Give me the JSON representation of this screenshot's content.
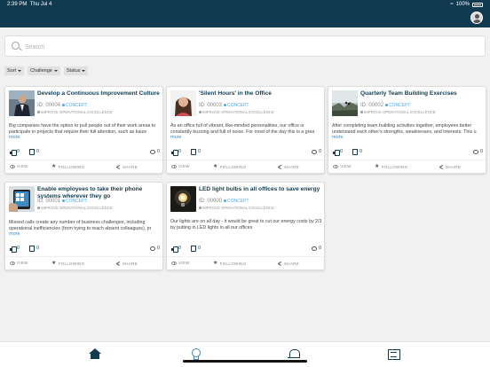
{
  "status_bar": {
    "time": "2:39 PM",
    "date": "Thu Jul 4",
    "battery": "100%"
  },
  "search": {
    "placeholder": "Search"
  },
  "filters": [
    {
      "label": "Sort"
    },
    {
      "label": "Challenge"
    },
    {
      "label": "Status"
    }
  ],
  "cards": [
    {
      "title": "Develop a Continuous Improvement Culture",
      "id": "ID: 00004",
      "stage": "CONCEPT",
      "challenge": "IMPROVE OPERATIONAL EXCELLENCE",
      "description": "Big companies have the option to pull people out of their work areas to participate in projects that require their full attention, such as kaize",
      "more": "more",
      "likes": "0",
      "dislikes": "0",
      "comments": "0",
      "view": "VIEW",
      "following": "FOLLOWING",
      "share": "SHARE",
      "thumb": "office-man"
    },
    {
      "title": "'Silent Hours' in the Office",
      "id": "ID: 00003",
      "stage": "CONCEPT",
      "challenge": "IMPROVE OPERATIONAL EXCELLENCE",
      "description": "As an office full of vibrant, like-minded personalities, our office is constantly buzzing and full of noise. For most of the day this is a grea",
      "more": "more",
      "likes": "0",
      "dislikes": "0",
      "comments": "0",
      "view": "VIEW",
      "following": "FOLLOWING",
      "share": "SHARE",
      "thumb": "woman-shh"
    },
    {
      "title": "Quarterly Team Building Exercises",
      "id": "ID: 00002",
      "stage": "CONCEPT",
      "challenge": "IMPROVE OPERATIONAL EXCELLENCE",
      "description": "After completing team building activities together, employees better understand each other's strengths, weaknesses, and interests. This u",
      "more": "more",
      "likes": "0",
      "dislikes": "0",
      "comments": "0",
      "view": "VIEW",
      "following": "FOLLOWING",
      "share": "SHARE",
      "thumb": "mountain-team"
    },
    {
      "title": "Enable employees to take their phone systems wherever they go",
      "id": "ID: 00001",
      "stage": "CONCEPT",
      "challenge": "IMPROVE OPERATIONAL EXCELLENCE",
      "description": "Missed calls create any number of business challenges, including operational inefficiencies (from trying to reach absent colleagues), pr",
      "more": "more",
      "likes": "0",
      "dislikes": "0",
      "comments": "0",
      "view": "VIEW",
      "following": "FOLLOWING",
      "share": "SHARE",
      "thumb": "phone-app"
    },
    {
      "title": "LED light bulbs in all offices to save energy",
      "id": "ID: 00000",
      "stage": "CONCEPT",
      "challenge": "IMPROVE OPERATIONAL EXCELLENCE",
      "description": "Our lights are on all day - it would be great to cut our energy costs by 2/3 by putting in LED lights in all our offices",
      "more": "",
      "likes": "0",
      "dislikes": "0",
      "comments": "0",
      "view": "VIEW",
      "following": "FOLLOWING",
      "share": "SHARE",
      "thumb": "light-bulb"
    }
  ],
  "tabbar": {
    "items": [
      "home-icon",
      "lightbulb-icon",
      "bell-icon",
      "list-icon"
    ],
    "active": "lightbulb-icon"
  },
  "colors": {
    "header": "#123a4f",
    "accent": "#3c86b5",
    "stage": "#5aa7d6"
  }
}
